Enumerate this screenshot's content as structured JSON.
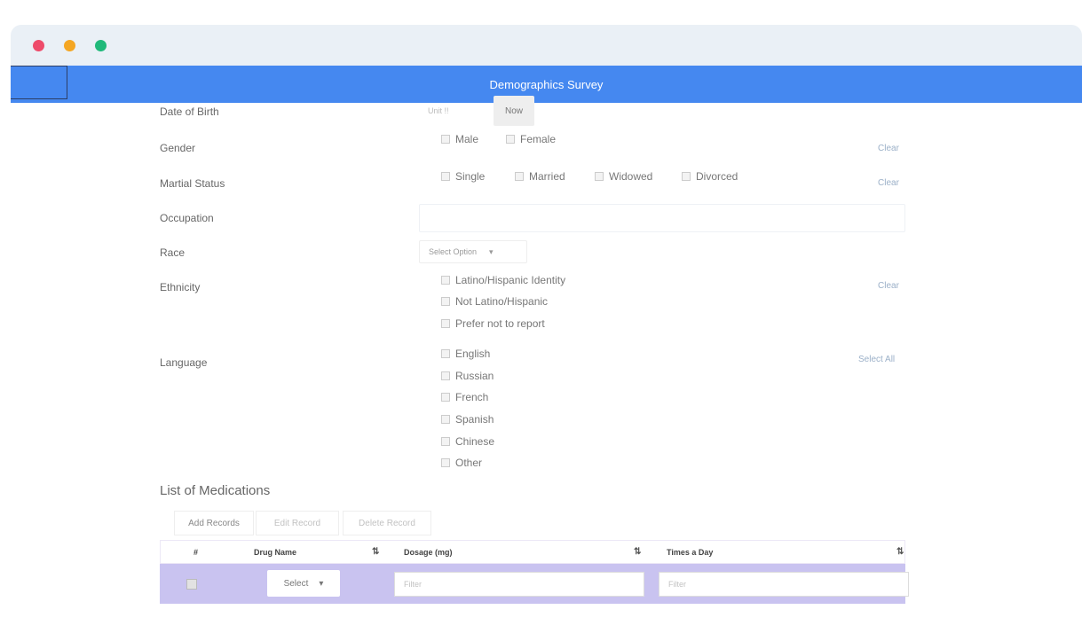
{
  "window": {
    "controls": [
      "close",
      "minimize",
      "maximize"
    ]
  },
  "header": {
    "title": "Demographics Survey"
  },
  "form": {
    "dob": {
      "label": "Date of Birth",
      "placeholder": "Unit !!",
      "now_label": "Now"
    },
    "gender": {
      "label": "Gender",
      "options": [
        "Male",
        "Female"
      ],
      "clear_label": "Clear"
    },
    "marital": {
      "label": "Martial Status",
      "options": [
        "Single",
        "Married",
        "Widowed",
        "Divorced"
      ],
      "clear_label": "Clear"
    },
    "occupation": {
      "label": "Occupation",
      "value": ""
    },
    "race": {
      "label": "Race",
      "select_value": "Select Option"
    },
    "ethnicity": {
      "label": "Ethnicity",
      "options": [
        "Latino/Hispanic Identity",
        "Not Latino/Hispanic",
        "Prefer not to report"
      ],
      "clear_label": "Clear"
    },
    "language": {
      "label": "Language",
      "options": [
        "English",
        "Russian",
        "French",
        "Spanish",
        "Chinese",
        "Other"
      ],
      "select_all_label": "Select All"
    }
  },
  "medications": {
    "title": "List of Medications",
    "buttons": {
      "add": "Add Records",
      "edit": "Edit Record",
      "delete": "Delete Record"
    },
    "columns": {
      "index": "#",
      "drug": "Drug Name",
      "dosage": "Dosage (mg)",
      "times": "Times a Day"
    },
    "sort_icon": "⇅",
    "row": {
      "select_value": "Select",
      "dosage_filter": "Filter",
      "times_filter": "Filter"
    }
  },
  "colors": {
    "header": "#4588f0",
    "row_highlight": "#c9c3f0",
    "titlebar": "#eaf0f6"
  }
}
